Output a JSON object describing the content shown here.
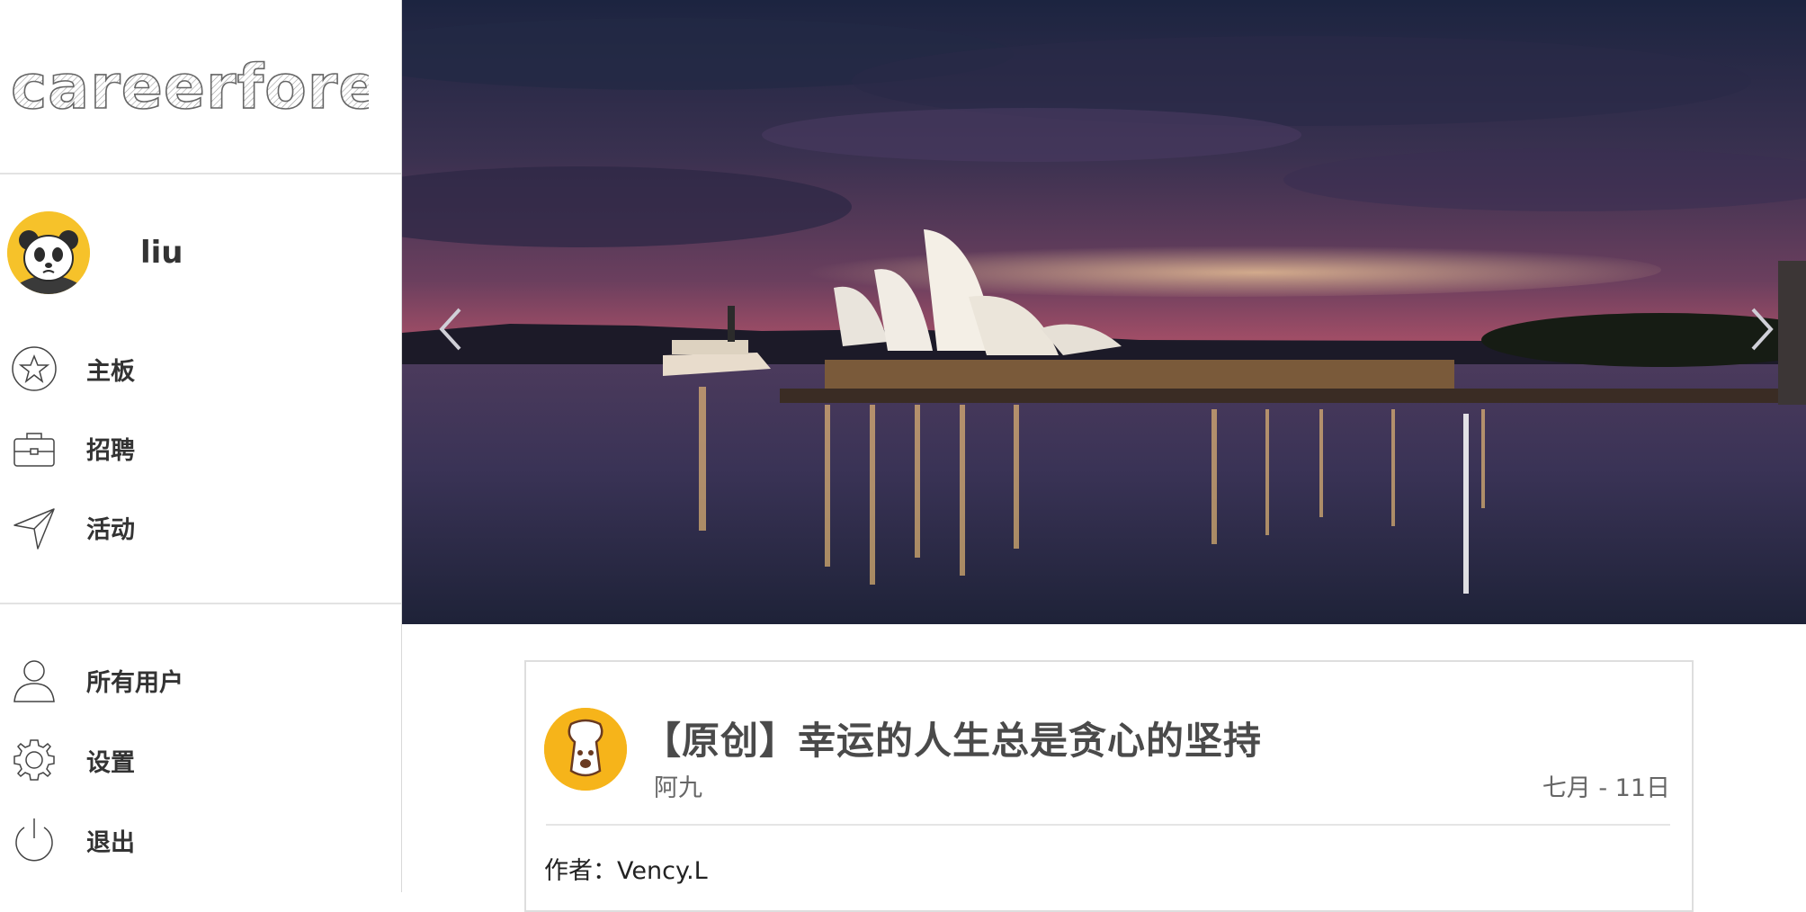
{
  "brand": {
    "logo_text": "careerfore"
  },
  "user": {
    "name": "liu"
  },
  "nav_primary": [
    {
      "label": "主板",
      "icon": "star-icon"
    },
    {
      "label": "招聘",
      "icon": "briefcase-icon"
    },
    {
      "label": "活动",
      "icon": "send-arrow-icon"
    }
  ],
  "nav_secondary": [
    {
      "label": "所有用户",
      "icon": "user-icon"
    },
    {
      "label": "设置",
      "icon": "gear-icon"
    },
    {
      "label": "退出",
      "icon": "power-icon"
    }
  ],
  "carousel": {
    "prev_icon": "chevron-left-icon",
    "next_icon": "chevron-right-icon"
  },
  "post": {
    "title": "【原创】幸运的人生总是贪心的坚持",
    "author": "阿九",
    "date": "七月 - 11日",
    "body_first_line": "作者：Vency.L"
  },
  "colors": {
    "avatar_bg": "#f6c22a",
    "post_avatar_bg": "#f6b41a",
    "text": "#333333",
    "muted": "#666666"
  }
}
